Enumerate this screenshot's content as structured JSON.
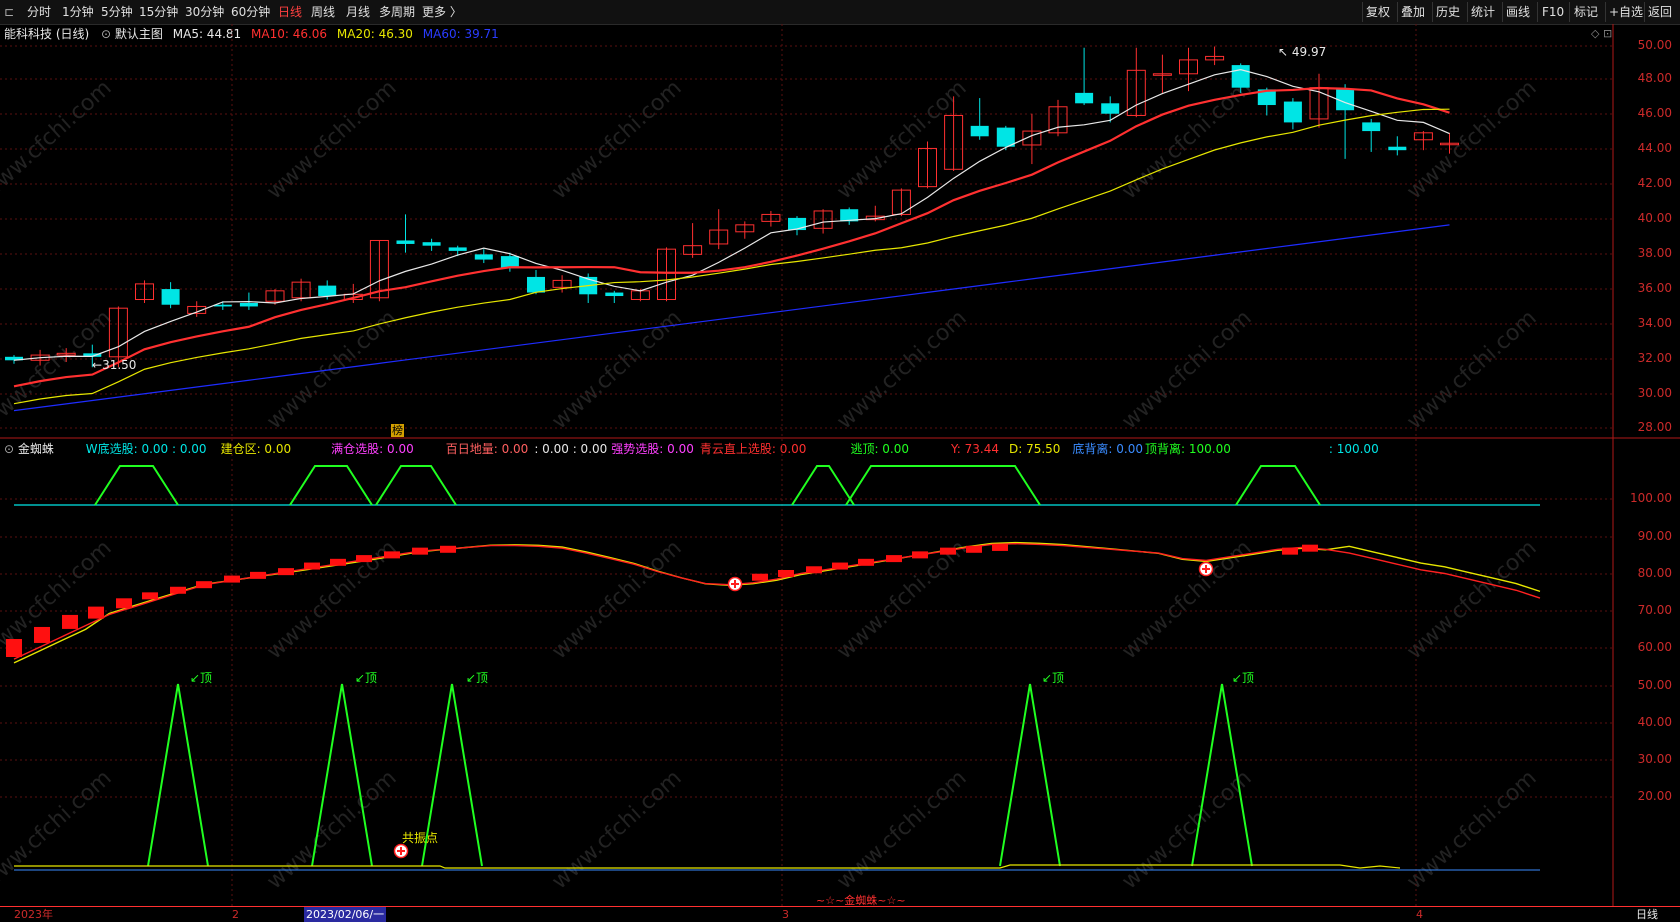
{
  "periods": [
    "分时",
    "1分钟",
    "5分钟",
    "15分钟",
    "30分钟",
    "60分钟",
    "日线",
    "周线",
    "月线",
    "多周期",
    "更多 〉"
  ],
  "active_period": "日线",
  "right_tools": [
    "复权",
    "叠加",
    "历史",
    "统计",
    "画线",
    "F10",
    "标记",
    "+自选",
    "返回"
  ],
  "stock_title": "能科科技 (日线)",
  "main_chart_name": "默认主图",
  "ma": {
    "ma5": {
      "label": "MA5: 44.81",
      "color": "#e8e8e8"
    },
    "ma10": {
      "label": "MA10: 46.06",
      "color": "#ff3030"
    },
    "ma20": {
      "label": "MA20: 46.30",
      "color": "#e6e600"
    },
    "ma60": {
      "label": "MA60: 39.71",
      "color": "#1e2cff"
    }
  },
  "main_y_labels": [
    "50.00",
    "48.00",
    "46.00",
    "44.00",
    "42.00",
    "40.00",
    "38.00",
    "36.00",
    "34.00",
    "32.00",
    "30.00",
    "28.00"
  ],
  "high_marker": "49.97",
  "low_marker": "31.50",
  "event_marker": "榜",
  "indicator": {
    "name": "金蜘蛛",
    "items": [
      {
        "label": "W底选股:",
        "value": "0.00 : 0.00",
        "color": "#00e5e5"
      },
      {
        "label": "建仓区:",
        "value": "0.00",
        "color": "#e6e600"
      },
      {
        "label": "满仓选股:",
        "value": "0.00",
        "color": "#ff40ff"
      },
      {
        "label": "百日地量:",
        "value": "0.00",
        "color": "#ff6060"
      },
      {
        "label": "",
        "value": ": 0.00 : 0.00",
        "color": "#e8e8e8"
      },
      {
        "label": "强势选股:",
        "value": "0.00",
        "color": "#ff40ff"
      },
      {
        "label": "青云直上选股:",
        "value": "0.00",
        "color": "#ff3030"
      },
      {
        "label": "逃顶:",
        "value": "0.00",
        "color": "#20ff20"
      },
      {
        "label": "Y:",
        "value": "73.44",
        "color": "#ff3030"
      },
      {
        "label": "D:",
        "value": "75.50",
        "color": "#e6e600"
      },
      {
        "label": "底背离:",
        "value": "0.00",
        "color": "#3a8cff"
      },
      {
        "label": "顶背离:",
        "value": "100.00",
        "color": "#20ff20"
      },
      {
        "label": "",
        "value": ": 100.00",
        "color": "#00e5e5"
      }
    ],
    "y_labels": [
      "100.00",
      "90.00",
      "80.00",
      "70.00",
      "60.00",
      "50.00",
      "40.00",
      "30.00",
      "20.00"
    ],
    "top_label": "顶",
    "resonance_label": "共振点",
    "footer": "~☆~金蜘蛛~☆~"
  },
  "time_axis": {
    "labels": [
      "2023年",
      "2",
      "2023/02/06/一",
      "3",
      "4"
    ],
    "period_label": "日线"
  },
  "watermark": "www.cfchi.com",
  "colors": {
    "up": "#ff3030",
    "down": "#00e5e5",
    "grid": "#5a1010",
    "border": "#b01818"
  }
}
